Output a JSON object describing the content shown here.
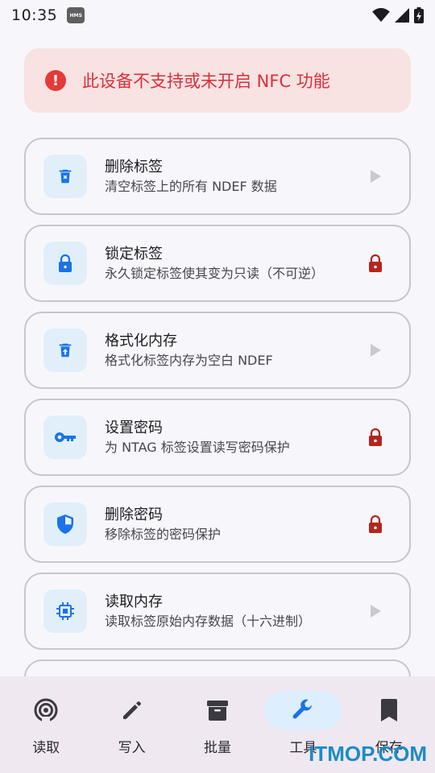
{
  "status_bar": {
    "time": "10:35",
    "hms_badge": "HMS"
  },
  "banner": {
    "icon": "!",
    "text": "此设备不支持或未开启 NFC 功能"
  },
  "tools": [
    {
      "title": "删除标签",
      "desc": "清空标签上的所有 NDEF 数据",
      "icon": "delete-x-icon",
      "trailing": "play-arrow-icon",
      "locked": false
    },
    {
      "title": "锁定标签",
      "desc": "永久锁定标签使其变为只读（不可逆）",
      "icon": "lock-icon",
      "trailing": "lock-icon",
      "locked": true
    },
    {
      "title": "格式化内存",
      "desc": "格式化标签内存为空白 NDEF",
      "icon": "delete-upload-icon",
      "trailing": "play-arrow-icon",
      "locked": false
    },
    {
      "title": "设置密码",
      "desc": "为 NTAG 标签设置读写密码保护",
      "icon": "key-icon",
      "trailing": "lock-icon",
      "locked": true
    },
    {
      "title": "删除密码",
      "desc": "移除标签的密码保护",
      "icon": "shield-icon",
      "trailing": "lock-icon",
      "locked": true
    },
    {
      "title": "读取内存",
      "desc": "读取标签原始内存数据（十六进制）",
      "icon": "chip-icon",
      "trailing": "play-arrow-icon",
      "locked": false
    }
  ],
  "nav": [
    {
      "label": "读取",
      "icon": "nfc-icon",
      "active": false
    },
    {
      "label": "写入",
      "icon": "pencil-icon",
      "active": false
    },
    {
      "label": "批量",
      "icon": "archive-icon",
      "active": false
    },
    {
      "label": "工具",
      "icon": "wrench-icon",
      "active": true
    },
    {
      "label": "保存",
      "icon": "bookmark-icon",
      "active": false
    }
  ],
  "colors": {
    "accent": "#1a73e8",
    "danger": "#d8303a",
    "lock": "#b3261e",
    "banner_bg": "#f8e2e2",
    "icon_box": "#e1effb"
  },
  "watermark": "ITMOP.COM"
}
